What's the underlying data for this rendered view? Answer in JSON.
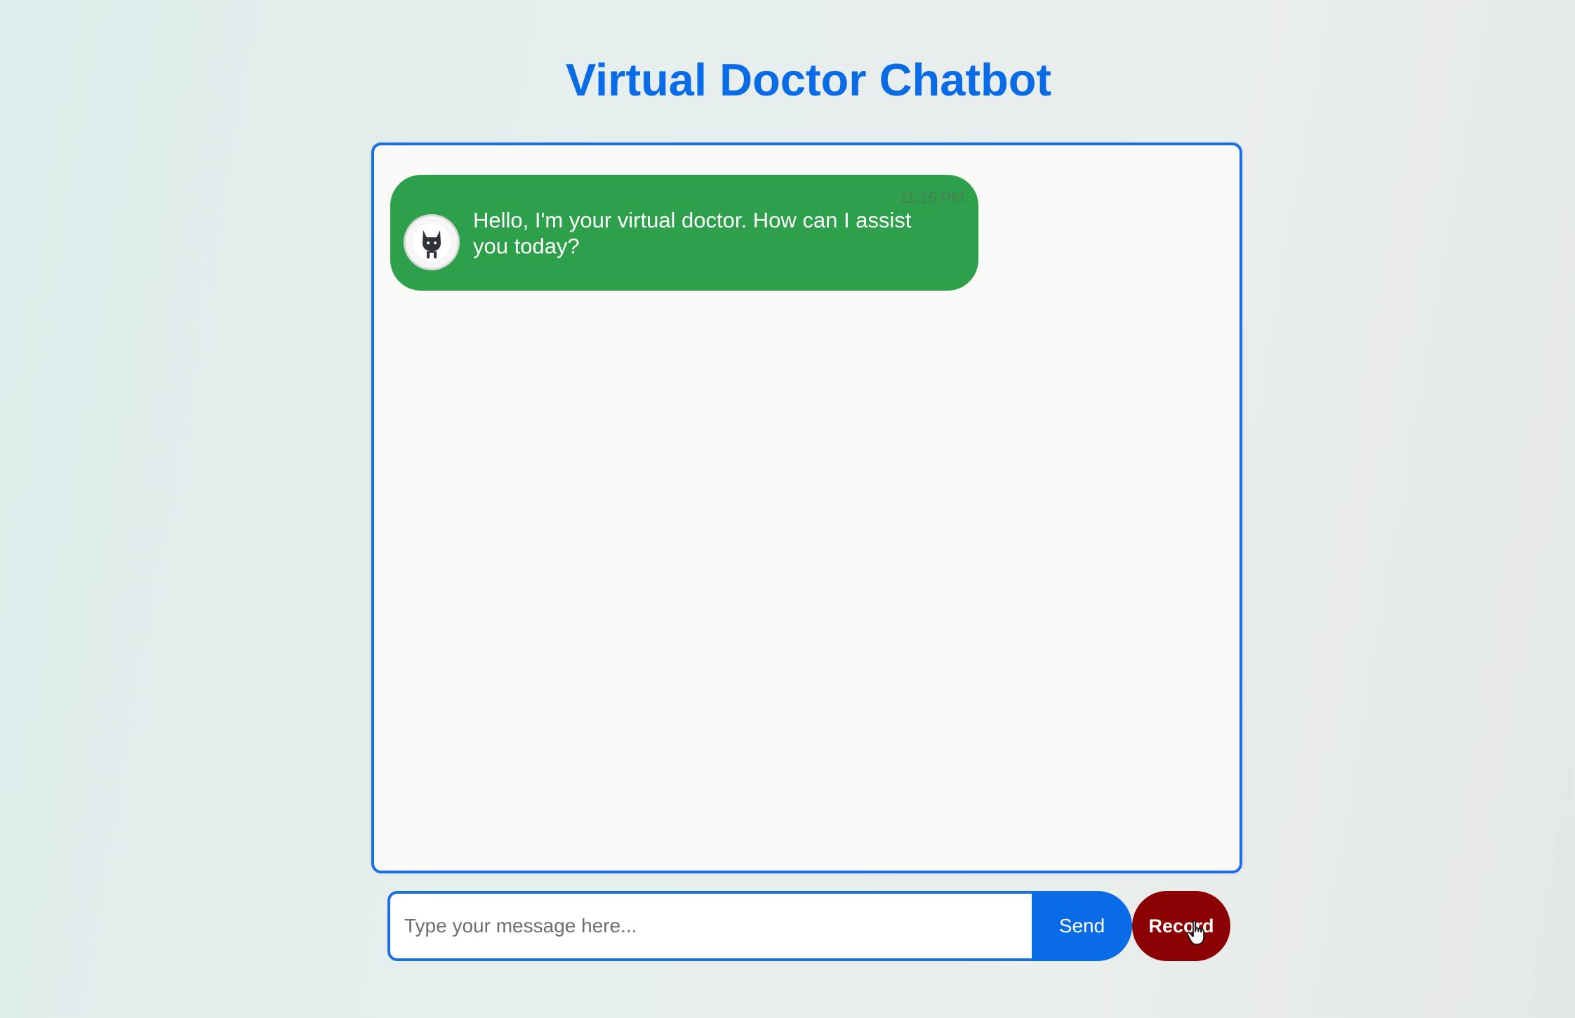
{
  "header": {
    "title": "Virtual Doctor Chatbot"
  },
  "chat": {
    "messages": [
      {
        "sender": "bot",
        "avatar_icon": "cat-avatar-icon",
        "time": "11:15 PM",
        "text": "Hello, I'm your virtual doctor. How can I assist you today?"
      }
    ]
  },
  "composer": {
    "input_value": "",
    "input_placeholder": "Type your message here...",
    "send_label": "Send",
    "record_label": "Record"
  },
  "colors": {
    "accent": "#0a6be6",
    "bot_bubble": "#2ea04b",
    "record_button": "#8b0000"
  }
}
